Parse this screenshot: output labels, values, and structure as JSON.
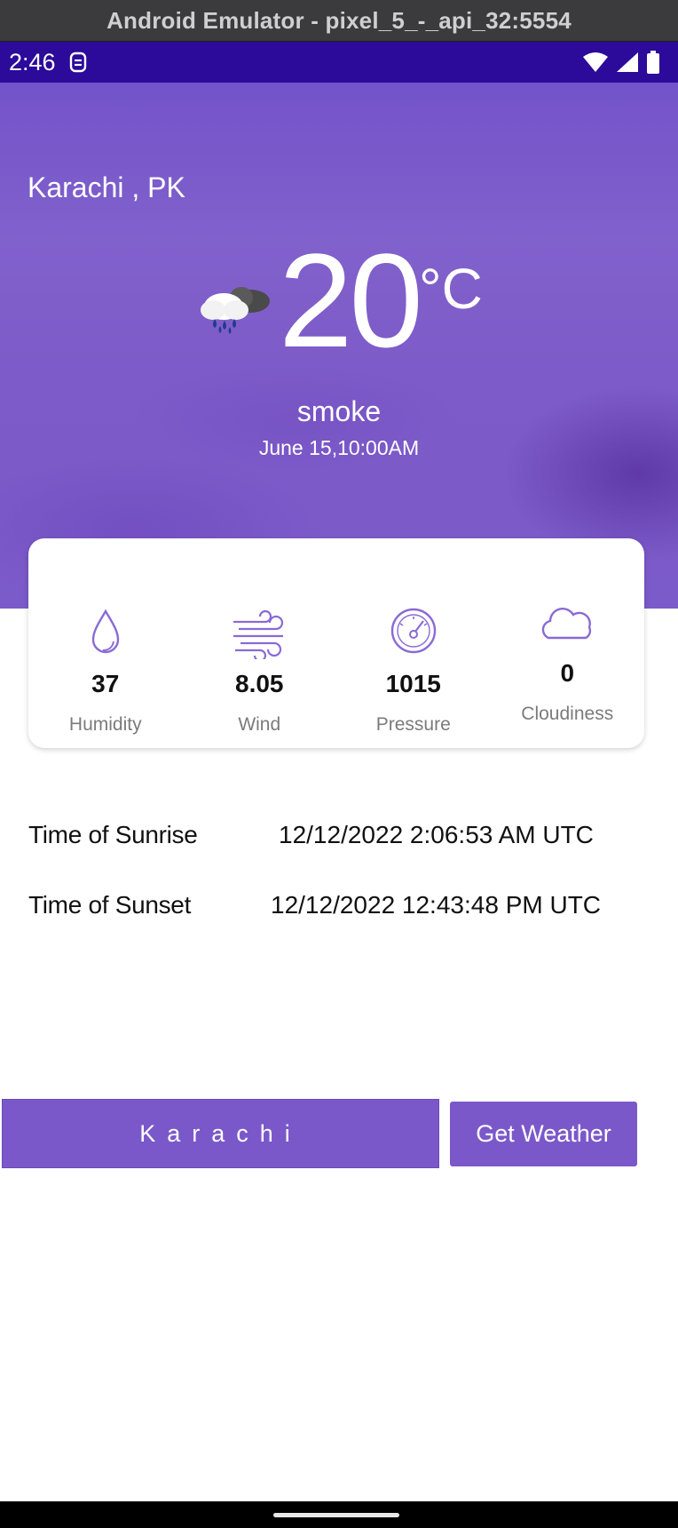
{
  "window": {
    "title": "Android Emulator - pixel_5_-_api_32:5554"
  },
  "status_bar": {
    "time": "2:46",
    "icons": [
      "sim-icon",
      "wifi-icon",
      "signal-icon",
      "battery-icon"
    ]
  },
  "weather": {
    "city": "Karachi , PK",
    "temperature": "20",
    "unit": "°C",
    "condition": "smoke",
    "datetime": "June 15,10:00AM",
    "icon": "rain-cloud-icon"
  },
  "stats": [
    {
      "icon": "humidity-drop-icon",
      "value": "37",
      "label": "Humidity"
    },
    {
      "icon": "wind-icon",
      "value": "8.05",
      "label": "Wind"
    },
    {
      "icon": "pressure-gauge-icon",
      "value": "1015",
      "label": "Pressure"
    },
    {
      "icon": "cloud-icon",
      "value": "0",
      "label": "Cloudiness"
    }
  ],
  "sun": {
    "sunrise_label": "Time of Sunrise",
    "sunrise_value": "12/12/2022 2:06:53 AM UTC",
    "sunset_label": "Time of Sunset",
    "sunset_value": "12/12/2022 12:43:48 PM UTC"
  },
  "search": {
    "value": "Karachi",
    "button_label": "Get Weather"
  },
  "colors": {
    "accent": "#7b58c9",
    "status_bar": "#2c0a9a",
    "icon_stroke": "#8a6ad6"
  }
}
